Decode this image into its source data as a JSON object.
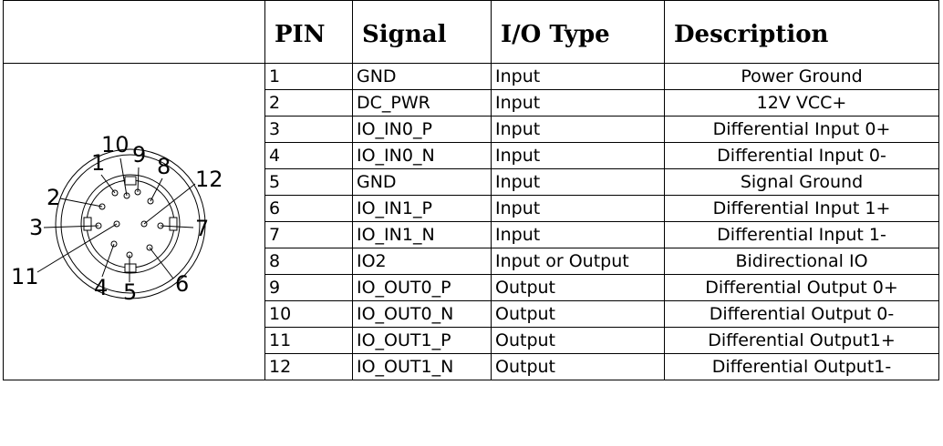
{
  "table": {
    "headers": [
      "PIN",
      "Signal",
      "I/O Type",
      "Description"
    ],
    "rows": [
      {
        "pin": "1",
        "signal": "GND",
        "io": "Input",
        "desc": "Power Ground"
      },
      {
        "pin": "2",
        "signal": "DC_PWR",
        "io": "Input",
        "desc": "12V VCC+"
      },
      {
        "pin": "3",
        "signal": "IO_IN0_P",
        "io": "Input",
        "desc": "Differential Input 0+"
      },
      {
        "pin": "4",
        "signal": "IO_IN0_N",
        "io": "Input",
        "desc": "Differential Input 0-"
      },
      {
        "pin": "5",
        "signal": "GND",
        "io": "Input",
        "desc": "Signal Ground"
      },
      {
        "pin": "6",
        "signal": "IO_IN1_P",
        "io": "Input",
        "desc": "Differential Input 1+"
      },
      {
        "pin": "7",
        "signal": "IO_IN1_N",
        "io": "Input",
        "desc": "Differential Input 1-"
      },
      {
        "pin": "8",
        "signal": "IO2",
        "io": "Input or Output",
        "desc": "Bidirectional IO"
      },
      {
        "pin": "9",
        "signal": "IO_OUT0_P",
        "io": "Output",
        "desc": "Differential Output 0+"
      },
      {
        "pin": "10",
        "signal": "IO_OUT0_N",
        "io": "Output",
        "desc": "Differential Output 0-"
      },
      {
        "pin": "11",
        "signal": "IO_OUT1_P",
        "io": "Output",
        "desc": "Differential Output1+"
      },
      {
        "pin": "12",
        "signal": "IO_OUT1_N",
        "io": "Output",
        "desc": "Differential Output1-"
      }
    ]
  },
  "connector": {
    "pin_labels": [
      "1",
      "2",
      "3",
      "4",
      "5",
      "6",
      "7",
      "8",
      "9",
      "10",
      "11",
      "12"
    ]
  }
}
